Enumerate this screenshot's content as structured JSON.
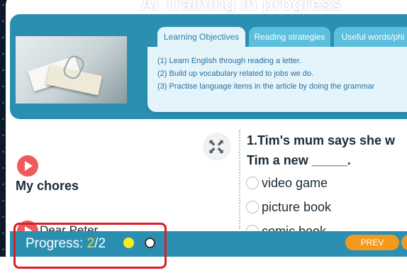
{
  "header": {
    "title": "AI Training in progress"
  },
  "tabs": [
    {
      "label": "Learning Objectives",
      "active": true
    },
    {
      "label": "Reading strategies",
      "active": false
    },
    {
      "label": "Useful words/phi",
      "active": false
    }
  ],
  "objectives": [
    "(1) Learn English through reading a letter.",
    "(2) Build up vocabulary related to jobs we do.",
    "(3) Practise language items in the article by doing the grammar"
  ],
  "reading": {
    "title": "My chores",
    "letter_opening": "Dear Peter"
  },
  "question": {
    "line1": "1.Tim's mum says she w",
    "line2": "Tim a new _____.",
    "options": [
      "video game",
      "picture book",
      "comic book"
    ]
  },
  "footer": {
    "progress_label": "Progress: ",
    "progress_current": "2",
    "progress_total": "/2",
    "prev_label": "PREV"
  },
  "colors": {
    "panel_blue": "#2b8fb2",
    "tab_light": "#e4f4fb",
    "play_red": "#ef5b5b",
    "prev_orange": "#f39a1e",
    "progress_yellow": "#ffd93a",
    "highlight_red": "#d81f2a"
  },
  "icons": [
    "play-icon",
    "expand-icon"
  ]
}
